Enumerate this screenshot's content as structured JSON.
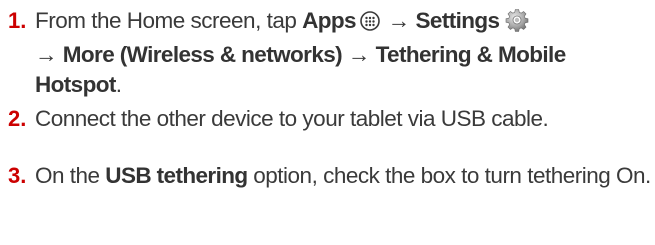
{
  "steps": [
    {
      "number": "1.",
      "text_from": "From the Home screen, tap ",
      "apps": "Apps",
      "arrow": "→",
      "settings": "Settings",
      "more": "More (Wireless & networks)",
      "tethering": "Tethering & Mobile Hotspot",
      "period": "."
    },
    {
      "number": "2.",
      "text": "Connect the other device to your tablet via USB cable."
    },
    {
      "number": "3.",
      "text_on_the": "On the ",
      "usb": "USB tethering",
      "text_rest": " option, check the box to turn tethering On."
    }
  ],
  "colors": {
    "step_number": "#cc0000",
    "body_text": "#3a3a3a"
  },
  "icons": [
    "apps-icon",
    "settings-gear-icon"
  ]
}
